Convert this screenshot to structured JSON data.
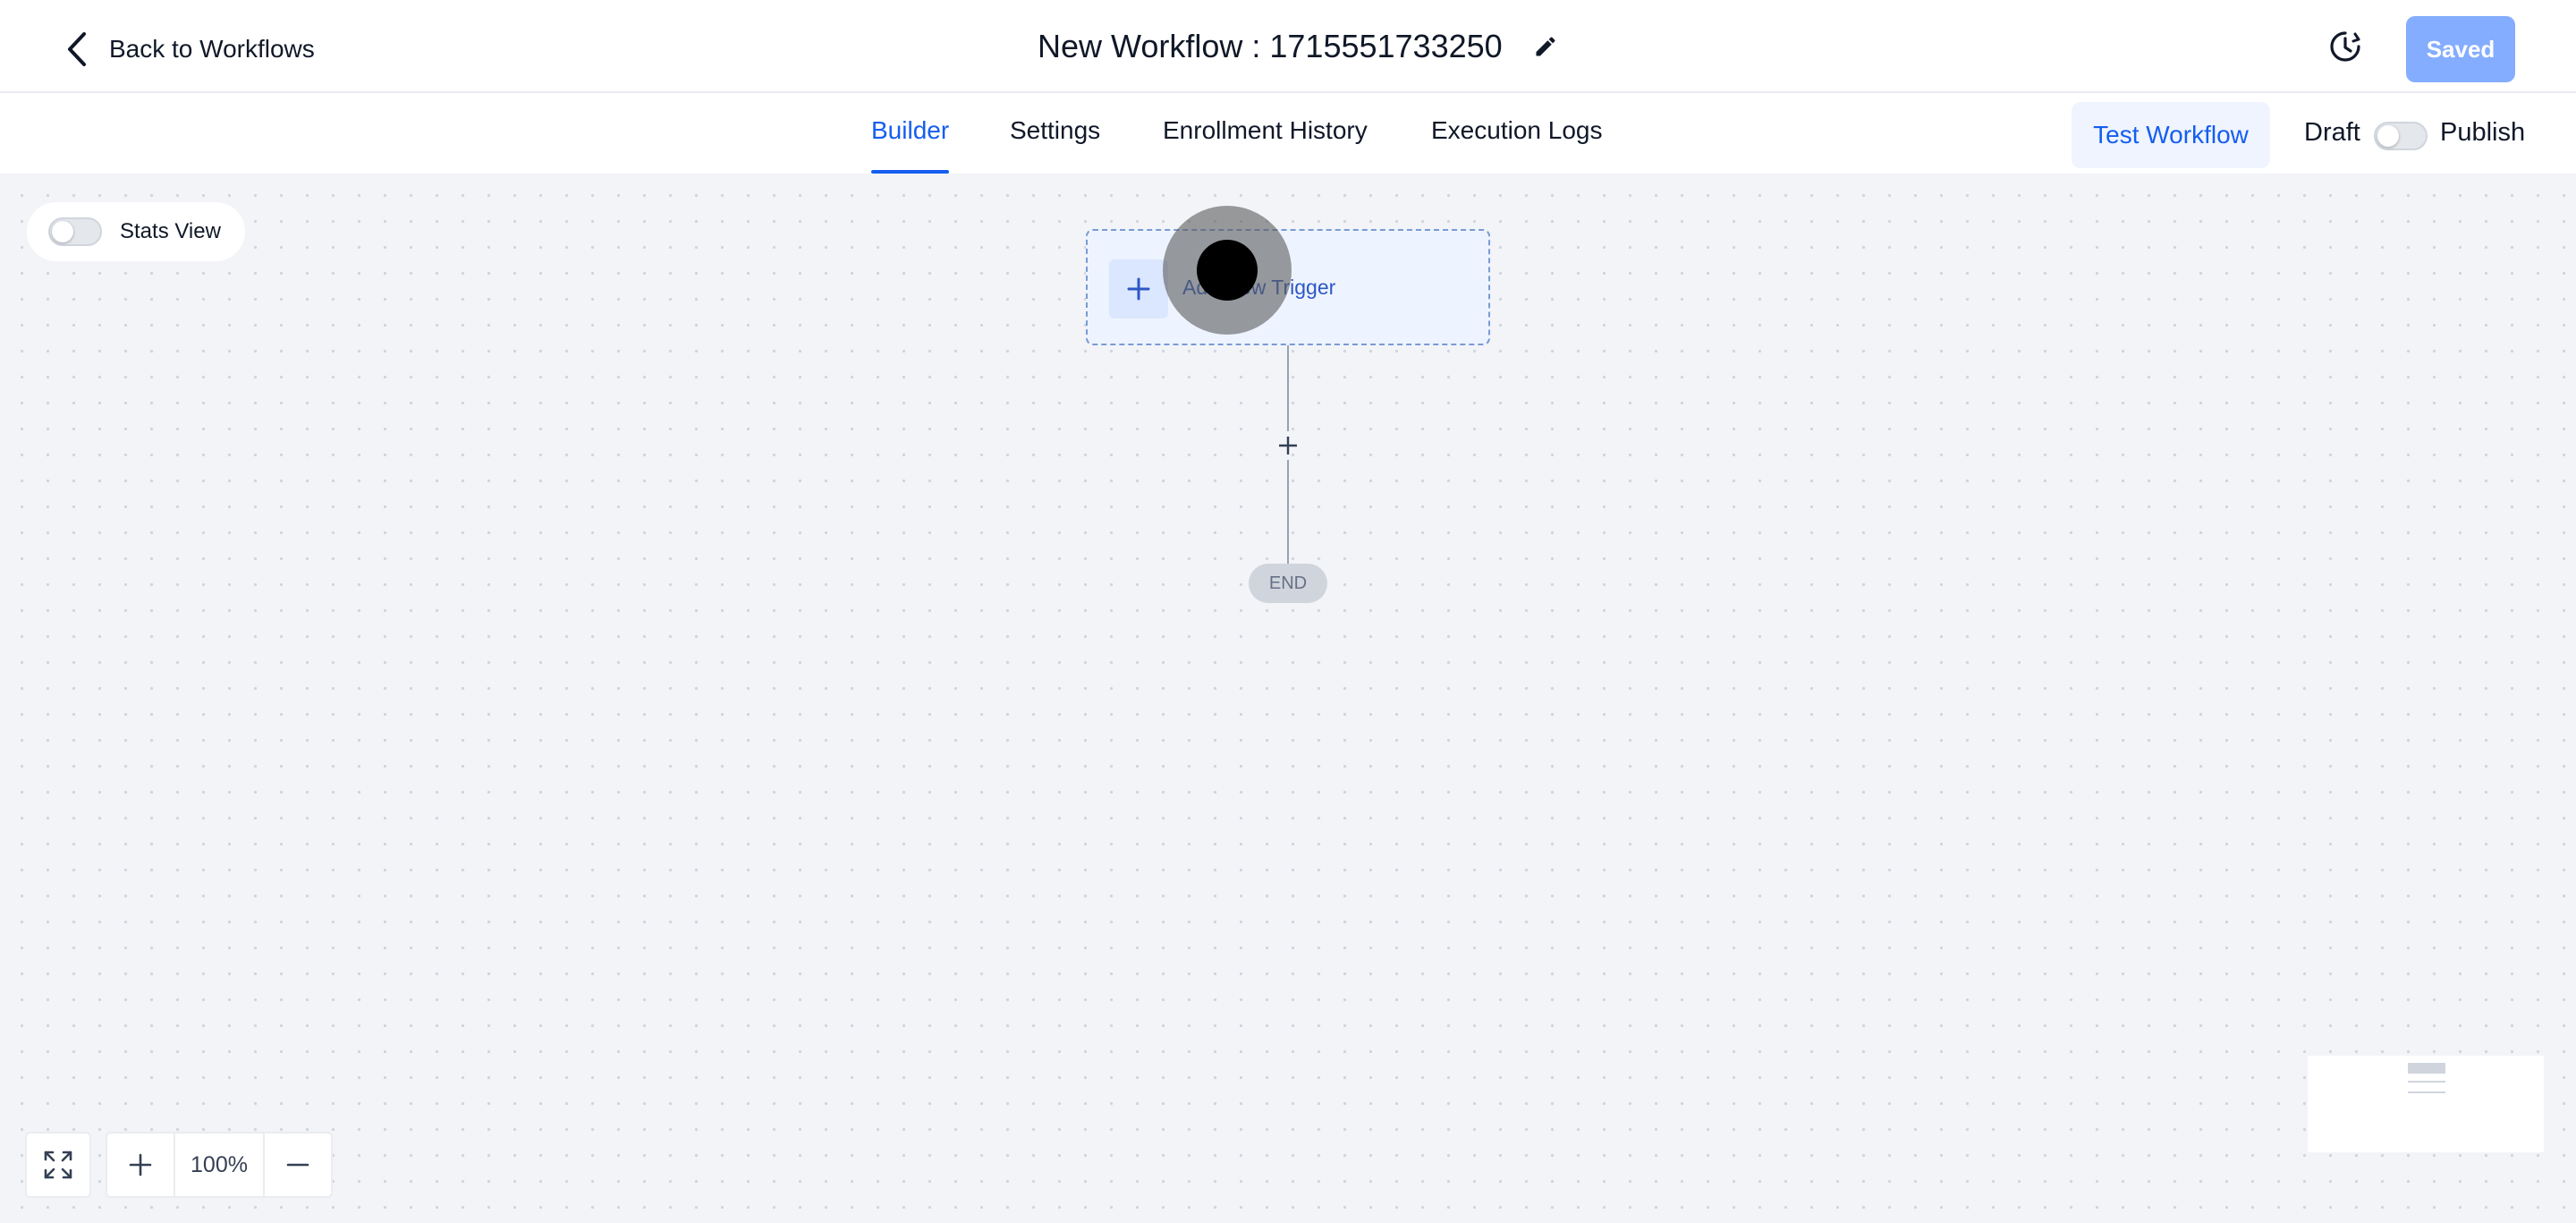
{
  "header": {
    "back_label": "Back to Workflows",
    "title": "New Workflow : 1715551733250",
    "saved_label": "Saved"
  },
  "tabs": [
    {
      "label": "Builder",
      "active": true
    },
    {
      "label": "Settings",
      "active": false
    },
    {
      "label": "Enrollment History",
      "active": false
    },
    {
      "label": "Execution Logs",
      "active": false
    }
  ],
  "actions": {
    "test_label": "Test Workflow",
    "draft_label": "Draft",
    "publish_label": "Publish",
    "publish_on": false
  },
  "canvas": {
    "stats_label": "Stats View",
    "stats_on": false,
    "trigger_label": "Add New Trigger",
    "end_label": "END"
  },
  "zoom": {
    "value": "100%"
  },
  "colors": {
    "accent": "#155eef",
    "saved_button": "#84adff",
    "canvas_bg": "#f2f4f7"
  },
  "icons": {
    "back": "chevron-left-icon",
    "edit": "pencil-icon",
    "history": "history-icon",
    "trigger_add": "plus-icon",
    "step_add": "plus-icon",
    "fit": "expand-icon",
    "zoom_in": "plus-icon",
    "zoom_out": "minus-icon"
  }
}
